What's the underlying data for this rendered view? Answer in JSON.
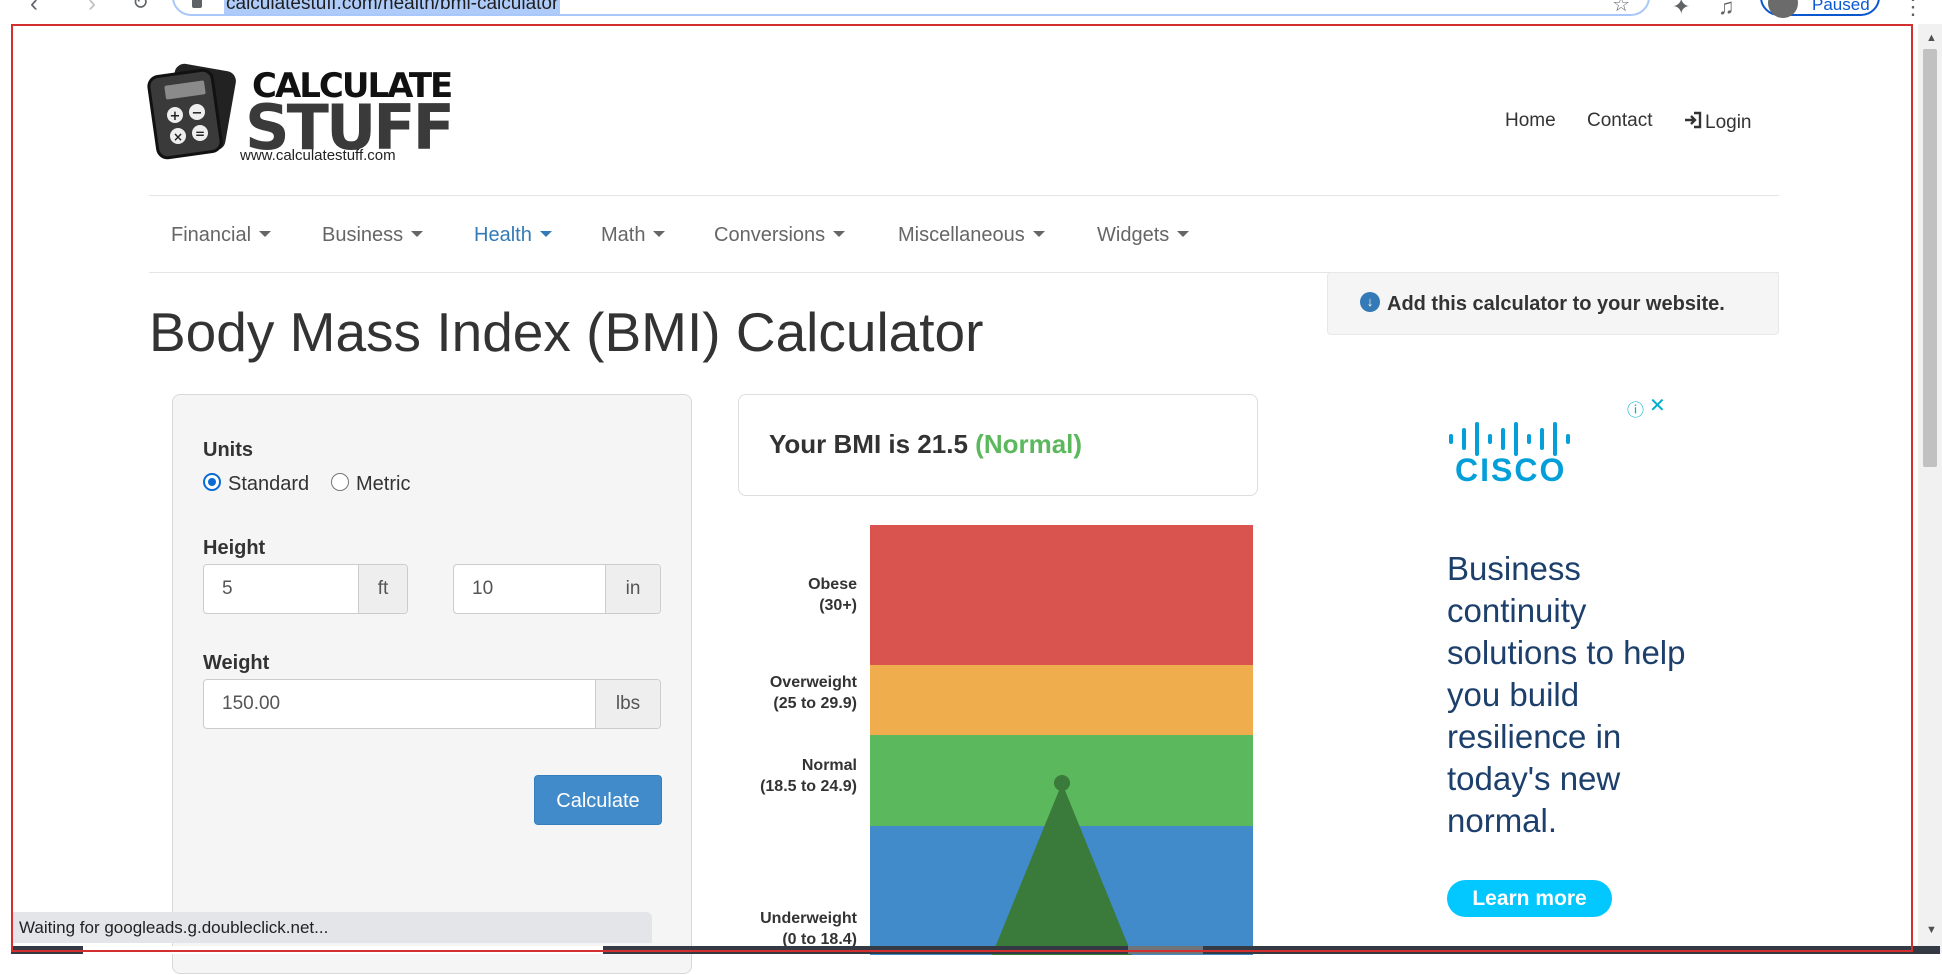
{
  "browser": {
    "url": "calculatestuff.com/health/bmi-calculator",
    "profile_status": "Paused"
  },
  "logo": {
    "word1": "CALCULATE",
    "word2": "STUFF",
    "url": "www.calculatestuff.com"
  },
  "top_links": {
    "home": "Home",
    "contact": "Contact",
    "login": "Login"
  },
  "nav": {
    "items": [
      {
        "label": "Financial",
        "active": false
      },
      {
        "label": "Business",
        "active": false
      },
      {
        "label": "Health",
        "active": true
      },
      {
        "label": "Math",
        "active": false
      },
      {
        "label": "Conversions",
        "active": false
      },
      {
        "label": "Miscellaneous",
        "active": false
      },
      {
        "label": "Widgets",
        "active": false
      }
    ]
  },
  "page": {
    "title": "Body Mass Index (BMI) Calculator",
    "add_widget": "Add this calculator to your website."
  },
  "form": {
    "units_label": "Units",
    "units_options": [
      "Standard",
      "Metric"
    ],
    "units_selected": "Standard",
    "height_label": "Height",
    "height_ft": "5",
    "height_ft_unit": "ft",
    "height_in": "10",
    "height_in_unit": "in",
    "weight_label": "Weight",
    "weight": "150.00",
    "weight_unit": "lbs",
    "calculate_label": "Calculate"
  },
  "result": {
    "prefix": "Your BMI is 21.5",
    "category": "(Normal)",
    "bmi": 21.5
  },
  "bmi_chart": {
    "bands": [
      {
        "name": "Obese",
        "range": "(30+)",
        "color": "#d9534f"
      },
      {
        "name": "Overweight",
        "range": "(25 to 29.9)",
        "color": "#f0ad4e"
      },
      {
        "name": "Normal",
        "range": "(18.5 to 24.9)",
        "color": "#5cb85c"
      },
      {
        "name": "Underweight",
        "range": "(0 to 18.4)",
        "color": "#428bca"
      }
    ],
    "indicator_color": "#3a7a3a"
  },
  "ad": {
    "brand": "CISCO",
    "copy": "Business continuity solutions to help you build resilience in today's new normal.",
    "cta": "Learn more"
  },
  "status_bar": {
    "text": "Waiting for googleads.g.doubleclick.net..."
  },
  "colors": {
    "link_blue": "#337ab7",
    "button_blue": "#428bca",
    "normal_green": "#5cb85c",
    "cisco_blue": "#049fd9",
    "ad_cta": "#02c8ff",
    "frame_red": "#d32f2f"
  }
}
